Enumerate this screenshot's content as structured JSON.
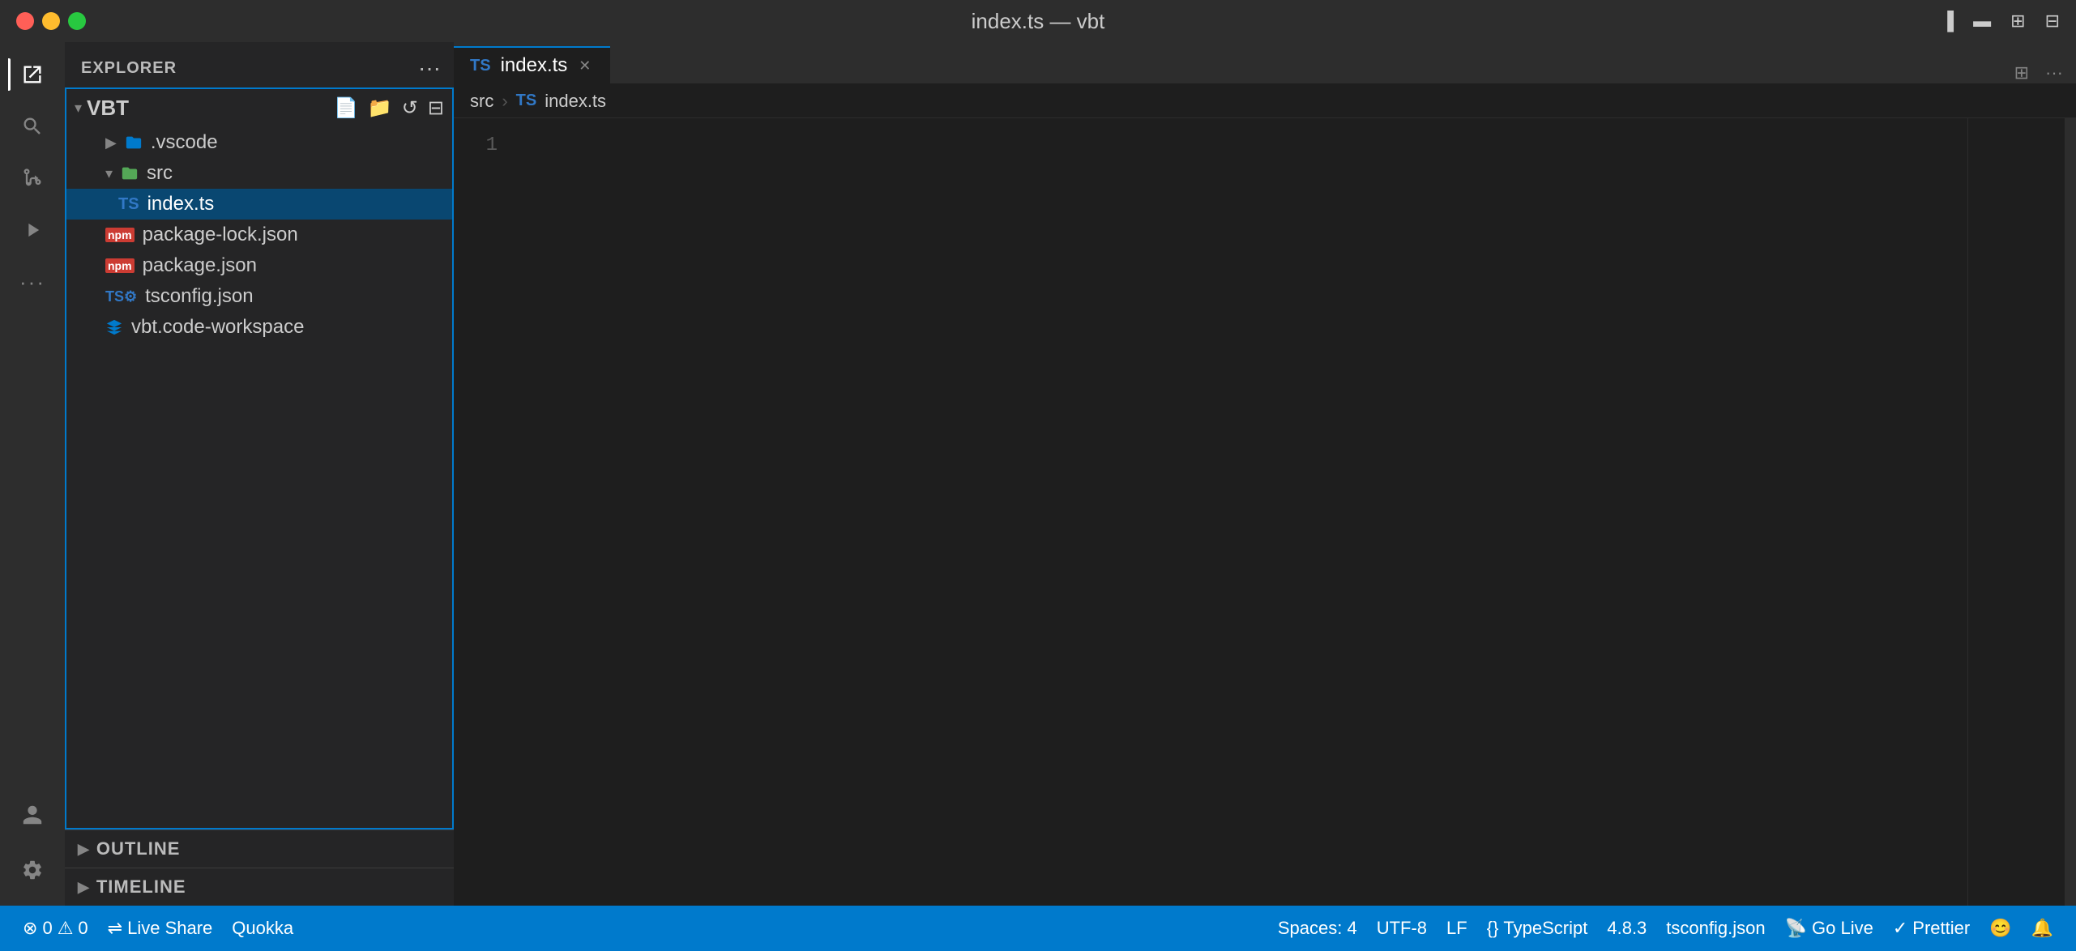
{
  "titlebar": {
    "title": "index.ts — vbt",
    "traffic": {
      "close": "close",
      "minimize": "minimize",
      "maximize": "maximize"
    },
    "actions": [
      "sidebar-toggle",
      "panel-toggle",
      "layout-toggle",
      "more-toggle"
    ]
  },
  "activity_bar": {
    "items": [
      {
        "id": "explorer",
        "icon": "⧉",
        "label": "Explorer",
        "active": true
      },
      {
        "id": "search",
        "icon": "🔍",
        "label": "Search",
        "active": false
      },
      {
        "id": "source-control",
        "icon": "⎇",
        "label": "Source Control",
        "active": false
      },
      {
        "id": "run",
        "icon": "▷",
        "label": "Run and Debug",
        "active": false
      },
      {
        "id": "extensions",
        "icon": "⋯",
        "label": "Extensions",
        "active": false
      }
    ],
    "bottom_items": [
      {
        "id": "accounts",
        "icon": "👤",
        "label": "Accounts"
      },
      {
        "id": "settings",
        "icon": "⚙",
        "label": "Settings"
      }
    ]
  },
  "sidebar": {
    "title": "EXPLORER",
    "more_label": "···",
    "toolbar": {
      "new_file": "New File",
      "new_folder": "New Folder",
      "refresh": "Refresh",
      "collapse": "Collapse"
    },
    "workspace": {
      "name": "VBT",
      "folders": [
        {
          "name": ".vscode",
          "expanded": false,
          "level": 1,
          "icon": "folder-vscode"
        },
        {
          "name": "src",
          "expanded": true,
          "level": 1,
          "icon": "folder-src",
          "children": [
            {
              "name": "index.ts",
              "type": "ts",
              "active": true
            }
          ]
        }
      ],
      "files": [
        {
          "name": "package-lock.json",
          "type": "json-pkg"
        },
        {
          "name": "package.json",
          "type": "json-pkg"
        },
        {
          "name": "tsconfig.json",
          "type": "tsconfig"
        },
        {
          "name": "vbt.code-workspace",
          "type": "vscode-workspace"
        }
      ]
    },
    "outline": {
      "label": "OUTLINE"
    },
    "timeline": {
      "label": "TIMELINE"
    }
  },
  "editor": {
    "tabs": [
      {
        "label": "index.ts",
        "type": "ts",
        "active": true,
        "dirty": false
      }
    ],
    "breadcrumb": [
      "src",
      "index.ts"
    ],
    "active_file": "index.ts",
    "line_numbers": [
      "1"
    ],
    "more_label": "···",
    "split_label": "Split Editor"
  },
  "statusbar": {
    "left": [
      {
        "id": "errors",
        "icon": "⊗",
        "text": "0",
        "extra": "⚠",
        "extra_text": "0"
      },
      {
        "id": "liveshare",
        "icon": "⇌",
        "text": "Live Share"
      },
      {
        "id": "quokka",
        "text": "Quokka"
      }
    ],
    "right": [
      {
        "id": "spaces",
        "text": "Spaces: 4"
      },
      {
        "id": "encoding",
        "text": "UTF-8"
      },
      {
        "id": "eol",
        "text": "LF"
      },
      {
        "id": "language",
        "icon": "{}",
        "text": "TypeScript"
      },
      {
        "id": "version",
        "text": "4.8.3"
      },
      {
        "id": "tsconfig",
        "text": "tsconfig.json"
      },
      {
        "id": "golive",
        "icon": "📡",
        "text": "Go Live"
      },
      {
        "id": "prettier",
        "icon": "✓",
        "text": "Prettier"
      },
      {
        "id": "feedback",
        "icon": "🔔"
      },
      {
        "id": "notifications",
        "icon": "🔔"
      }
    ]
  }
}
